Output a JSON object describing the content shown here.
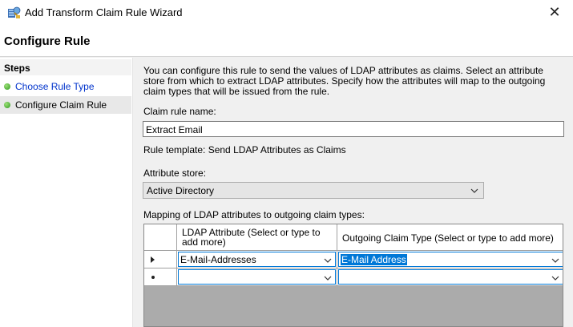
{
  "window": {
    "title": "Add Transform Claim Rule Wizard",
    "close_glyph": "✕"
  },
  "header": {
    "title": "Configure Rule"
  },
  "steps": {
    "title": "Steps",
    "items": [
      {
        "label": "Choose Rule Type",
        "status": "complete",
        "link": true
      },
      {
        "label": "Configure Claim Rule",
        "status": "current",
        "link": false
      }
    ]
  },
  "main": {
    "description": "You can configure this rule to send the values of LDAP attributes as claims. Select an attribute store from which to extract LDAP attributes. Specify how the attributes will map to the outgoing claim types that will be issued from the rule.",
    "rule_name_label": "Claim rule name:",
    "rule_name_value": "Extract Email",
    "rule_template": "Rule template: Send LDAP Attributes as Claims",
    "attribute_store_label": "Attribute store:",
    "attribute_store_value": "Active Directory",
    "mapping_label": "Mapping of LDAP attributes to outgoing claim types:",
    "mapping_table": {
      "columns": [
        "LDAP Attribute (Select or type to add more)",
        "Outgoing Claim Type (Select or type to add more)"
      ],
      "rows": [
        {
          "ldap_attribute": "E-Mail-Addresses",
          "claim_type": "E-Mail Address"
        },
        {
          "ldap_attribute": "",
          "claim_type": ""
        }
      ]
    }
  },
  "colors": {
    "accent": "#0078d7",
    "link": "#0033cc",
    "step_complete": "#3aa52a"
  }
}
